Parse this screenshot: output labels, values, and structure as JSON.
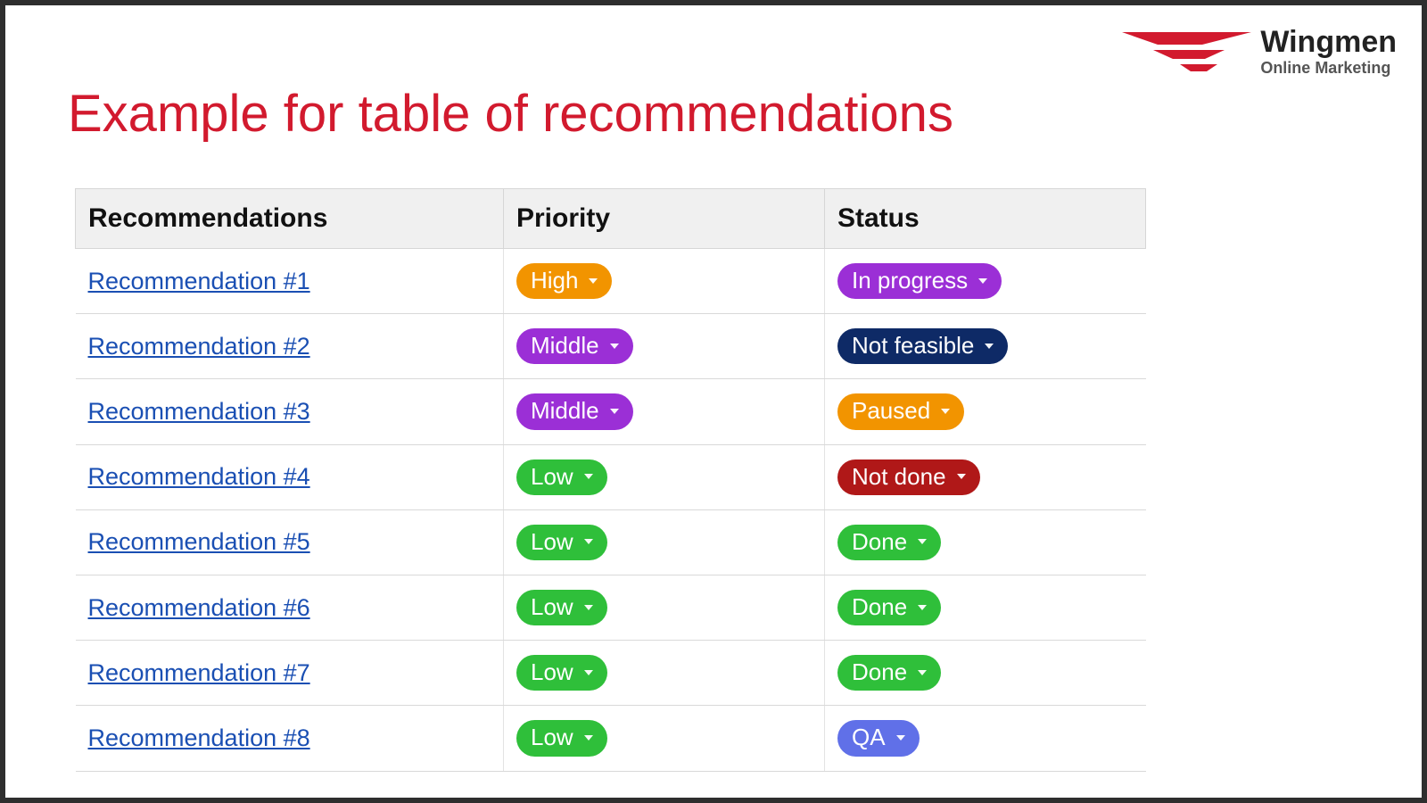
{
  "brand": {
    "name": "Wingmen",
    "tagline": "Online Marketing",
    "accent": "#d21a2e"
  },
  "title": "Example for table of recommendations",
  "table": {
    "headers": {
      "col1": "Recommendations",
      "col2": "Priority",
      "col3": "Status"
    },
    "rows": [
      {
        "name": "Recommendation #1",
        "priority": "High",
        "priority_color": "#f29400",
        "status": "In progress",
        "status_color": "#9b2fd6"
      },
      {
        "name": "Recommendation #2",
        "priority": "Middle",
        "priority_color": "#9b2fd6",
        "status": "Not feasible",
        "status_color": "#0e2a66"
      },
      {
        "name": "Recommendation #3",
        "priority": "Middle",
        "priority_color": "#9b2fd6",
        "status": "Paused",
        "status_color": "#f29400"
      },
      {
        "name": "Recommendation #4",
        "priority": "Low",
        "priority_color": "#2fbf3a",
        "status": "Not done",
        "status_color": "#b01818"
      },
      {
        "name": "Recommendation #5",
        "priority": "Low",
        "priority_color": "#2fbf3a",
        "status": "Done",
        "status_color": "#2fbf3a"
      },
      {
        "name": "Recommendation #6",
        "priority": "Low",
        "priority_color": "#2fbf3a",
        "status": "Done",
        "status_color": "#2fbf3a"
      },
      {
        "name": "Recommendation #7",
        "priority": "Low",
        "priority_color": "#2fbf3a",
        "status": "Done",
        "status_color": "#2fbf3a"
      },
      {
        "name": "Recommendation #8",
        "priority": "Low",
        "priority_color": "#2fbf3a",
        "status": "QA",
        "status_color": "#6070e8"
      }
    ]
  }
}
